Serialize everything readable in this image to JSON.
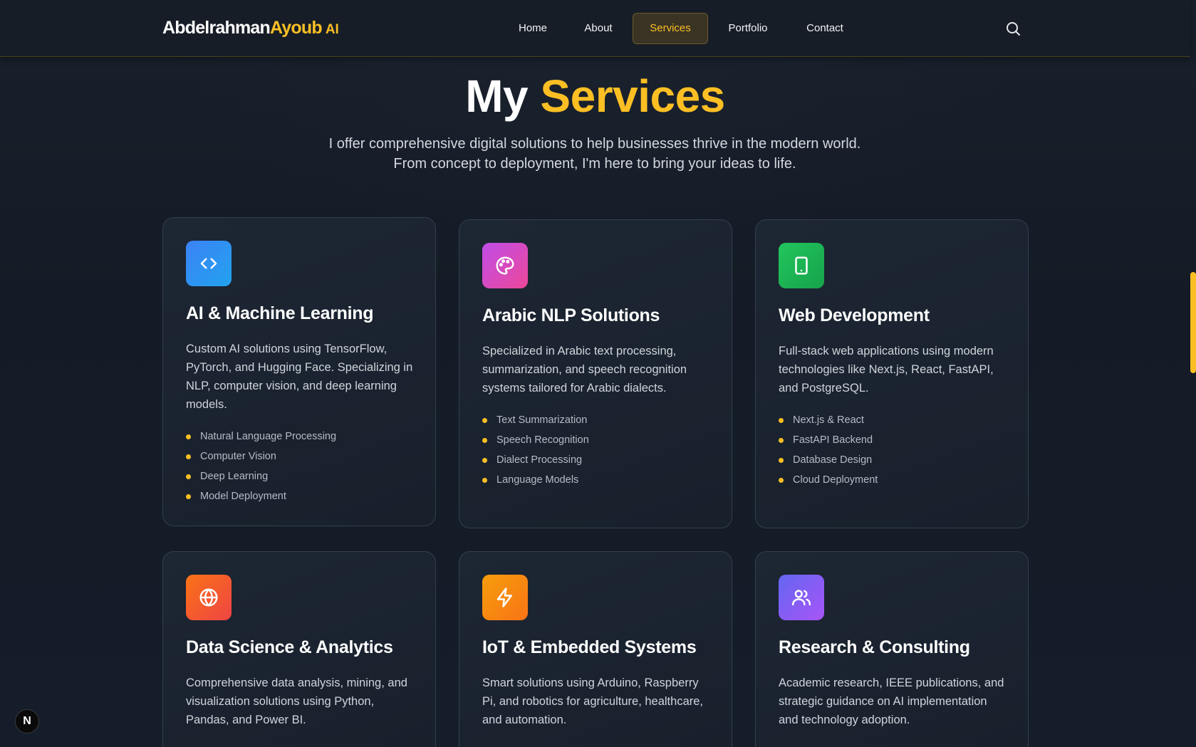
{
  "brand": {
    "first": "Abdelrahman",
    "second": "Ayoub",
    "suffix": "AI"
  },
  "nav": {
    "items": [
      {
        "label": "Home"
      },
      {
        "label": "About"
      },
      {
        "label": "Services"
      },
      {
        "label": "Portfolio"
      },
      {
        "label": "Contact"
      }
    ],
    "active": "Services"
  },
  "hero": {
    "title_white": "My",
    "title_accent": "Services",
    "subtitle": "I offer comprehensive digital solutions to help businesses thrive in the modern world. From concept to deployment, I'm here to bring your ideas to life."
  },
  "services": [
    {
      "icon": "code-icon",
      "title": "AI & Machine Learning",
      "description": "Custom AI solutions using TensorFlow, PyTorch, and Hugging Face. Specializing in NLP, computer vision, and deep learning models.",
      "features": [
        "Natural Language Processing",
        "Computer Vision",
        "Deep Learning",
        "Model Deployment"
      ]
    },
    {
      "icon": "palette-icon",
      "title": "Arabic NLP Solutions",
      "description": "Specialized in Arabic text processing, summarization, and speech recognition systems tailored for Arabic dialects.",
      "features": [
        "Text Summarization",
        "Speech Recognition",
        "Dialect Processing",
        "Language Models"
      ]
    },
    {
      "icon": "tablet-icon",
      "title": "Web Development",
      "description": "Full-stack web applications using modern technologies like Next.js, React, FastAPI, and PostgreSQL.",
      "features": [
        "Next.js & React",
        "FastAPI Backend",
        "Database Design",
        "Cloud Deployment"
      ]
    },
    {
      "icon": "globe-icon",
      "title": "Data Science & Analytics",
      "description": "Comprehensive data analysis, mining, and visualization solutions using Python, Pandas, and Power BI.",
      "features": []
    },
    {
      "icon": "lightning-icon",
      "title": "IoT & Embedded Systems",
      "description": "Smart solutions using Arduino, Raspberry Pi, and robotics for agriculture, healthcare, and automation.",
      "features": []
    },
    {
      "icon": "users-icon",
      "title": "Research & Consulting",
      "description": "Academic research, IEEE publications, and strategic guidance on AI implementation and technology adoption.",
      "features": []
    }
  ],
  "colors": {
    "accent": "#fbbf24",
    "background": "#141b26",
    "card_border": "#343e4c"
  },
  "dev_badge": "N"
}
